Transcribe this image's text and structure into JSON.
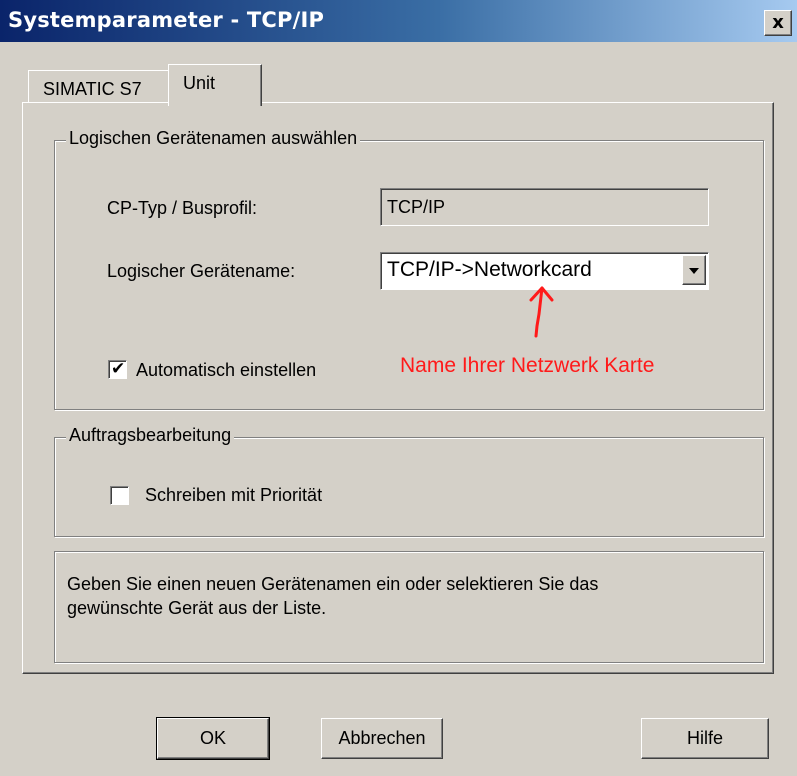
{
  "window": {
    "title": "Systemparameter - TCP/IP",
    "close_glyph": "x"
  },
  "tabs": [
    {
      "label": "SIMATIC S7"
    },
    {
      "label": "Unit"
    }
  ],
  "group_device": {
    "legend": "Logischen Gerätenamen auswählen",
    "cp_label": "CP-Typ / Busprofil:",
    "cp_value": "TCP/IP",
    "logical_label": "Logischer Gerätename:",
    "logical_value": "TCP/IP->Networkcard",
    "auto_checkbox_label": "Automatisch einstellen",
    "auto_checked": true,
    "annotation": "Name Ihrer Netzwerk Karte"
  },
  "group_jobs": {
    "legend": "Auftragsbearbeitung",
    "priority_checkbox_label": "Schreiben mit Priorität",
    "priority_checked": false
  },
  "info_text_line1": "Geben Sie einen neuen Gerätenamen ein oder selektieren Sie das",
  "info_text_line2": "gewünschte Gerät aus der Liste.",
  "buttons": {
    "ok": "OK",
    "cancel": "Abbrechen",
    "help": "Hilfe"
  },
  "colors": {
    "dialog_bg": "#d4d0c8",
    "titlebar_start": "#0a246a",
    "titlebar_end": "#a6caf0",
    "annotation": "#ff1a1a"
  }
}
